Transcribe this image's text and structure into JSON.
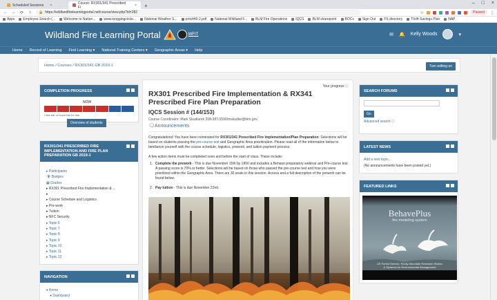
{
  "browser": {
    "tabs": [
      {
        "label": "Scheduled Sessions",
        "active": false
      },
      {
        "label": "Course: RX301/341 Prescribed Fi",
        "active": true
      }
    ],
    "url": "https://wildlandfirelearningportal.net/course/view.php?id=282",
    "bookmarks": [
      "Apps",
      "Employee Search (...",
      "Welcome to Nation...",
      "www.inoggingcircle...",
      "National Weather S...",
      "pms449-2.pdf",
      "National Wildland F...",
      "BLM Fire Operations",
      "IQCS",
      "BLM sharepoint",
      "BOCs",
      "Sign Out",
      "FS directory",
      "Thrift Savings Plan",
      "NAP"
    ],
    "paused_label": "Paused",
    "ext_colors": [
      "#e8a33d",
      "#d44",
      "#4a8",
      "#a5c",
      "#d74",
      "#47c",
      "#e53"
    ]
  },
  "site": {
    "title": "Wildland Fire Learning Portal",
    "wfit_label": "WFIT",
    "user_name": "Kelly Woods",
    "nav": [
      "Home",
      "Record of Learning",
      "Find Learning ▾",
      "National Training Centers ▾",
      "Geographic Areas ▾",
      "Help"
    ]
  },
  "breadcrumb": "Home  /  Courses  /  RX301/341 GB 2019-1",
  "edit_button": "Turn editing on",
  "completion": {
    "header": "COMPLETION PROGRESS",
    "now_label": "NOW",
    "hint": "Click bar or touch bar for info",
    "overview_button": "Overview of students",
    "segment_colors": [
      "#c9302c",
      "#c9302c",
      "#c9302c",
      "#c9302c",
      "#c9302c",
      "#2a5d9f",
      "#2a5d9f"
    ]
  },
  "course_block": {
    "header": "RX301/341 PRESCRIBED FIRE IMPLEMENTATION AND FIRE PLAN PREPARATION GB 2019-1",
    "items": [
      {
        "label": "▸ Participants",
        "dark": false
      },
      {
        "label": "🛡 Badges",
        "dark": false
      },
      {
        "label": "▦ Grades",
        "dark": false
      },
      {
        "label": "▸ RX301 Prescribed Fire Implementation & ...",
        "dark": true
      },
      {
        "label": "▸",
        "dark": true
      },
      {
        "label": "▸ Course Schedule and Logistics",
        "dark": true
      },
      {
        "label": "▸ Pre-work",
        "dark": true
      },
      {
        "label": "▸ Tuition",
        "dark": true
      },
      {
        "label": "▸ NFC Security",
        "dark": true
      },
      {
        "label": "▸ Topic 6",
        "dark": false
      },
      {
        "label": "▸ Topic 7",
        "dark": false
      },
      {
        "label": "▸ Topic 8",
        "dark": false
      },
      {
        "label": "▸ Topic 9",
        "dark": false
      },
      {
        "label": "▸ Topic 10",
        "dark": false
      },
      {
        "label": "▸ Topic 11",
        "dark": false
      },
      {
        "label": "▸ Topic 12",
        "dark": false
      }
    ]
  },
  "navigation_block": {
    "header": "NAVIGATION",
    "items": [
      "▾ Home",
      "● Dashboard"
    ]
  },
  "main": {
    "progress_label": "Your progress",
    "title": "RX301 Prescribed Fire Implementation & RX341 Prescribed Fire Plan Preparation",
    "session": "IQCS Session # (144/153)",
    "coordinator": "Course Coordinator: Mark Skudlarek 208-387-5590/mskudlar@blm.gov",
    "announcements": "Announcements",
    "intro_lead": "Congratulations!  You have been nominated for ",
    "intro_bold": "RX301/341 Prescribed Fire Implementation/Plan Preparation",
    "intro_mid": ":  Selections will be based on students passing the ",
    "intro_link": "pre-course test",
    "intro_tail": " and Geographic Area prioritization.  Please read all of the information below to familiarize yourself with the course schedule, logistics, prework, and tuition payment process.",
    "actions_intro": "A few action items must be completed soon and before the start of class.  These include:",
    "item1_bold": "Complete the prework",
    "item1_text": " - This is due November 15th by 1800 and includes a Behave preparatory webinar and Pre-course test .  A passing score is 70% or better.  Selections will be based on those who passed the pre-course test and how you were prioritized within the Geographic Area.  There are 30 seats in this session.  Access and a full description of the prework can be found below.",
    "item2_bold": "Pay tuition",
    "item2_text": " - This is due November 22nd."
  },
  "search_forums": {
    "header": "SEARCH FORUMS",
    "go_label": "Go",
    "advanced_label": "Advanced search"
  },
  "latest_news": {
    "header": "LATEST NEWS",
    "add_topic": "Add a new topic...",
    "empty": "(No announcements have been posted yet.)"
  },
  "featured_links": {
    "header": "FEATURED LINKS",
    "behave_title": "BehavePlus",
    "behave_subtitle": "fire modeling system",
    "behave_credit_1": "US Forest Service, Rocky Mountain Research Station",
    "behave_credit_2": "& Systems for Environmental Management"
  }
}
